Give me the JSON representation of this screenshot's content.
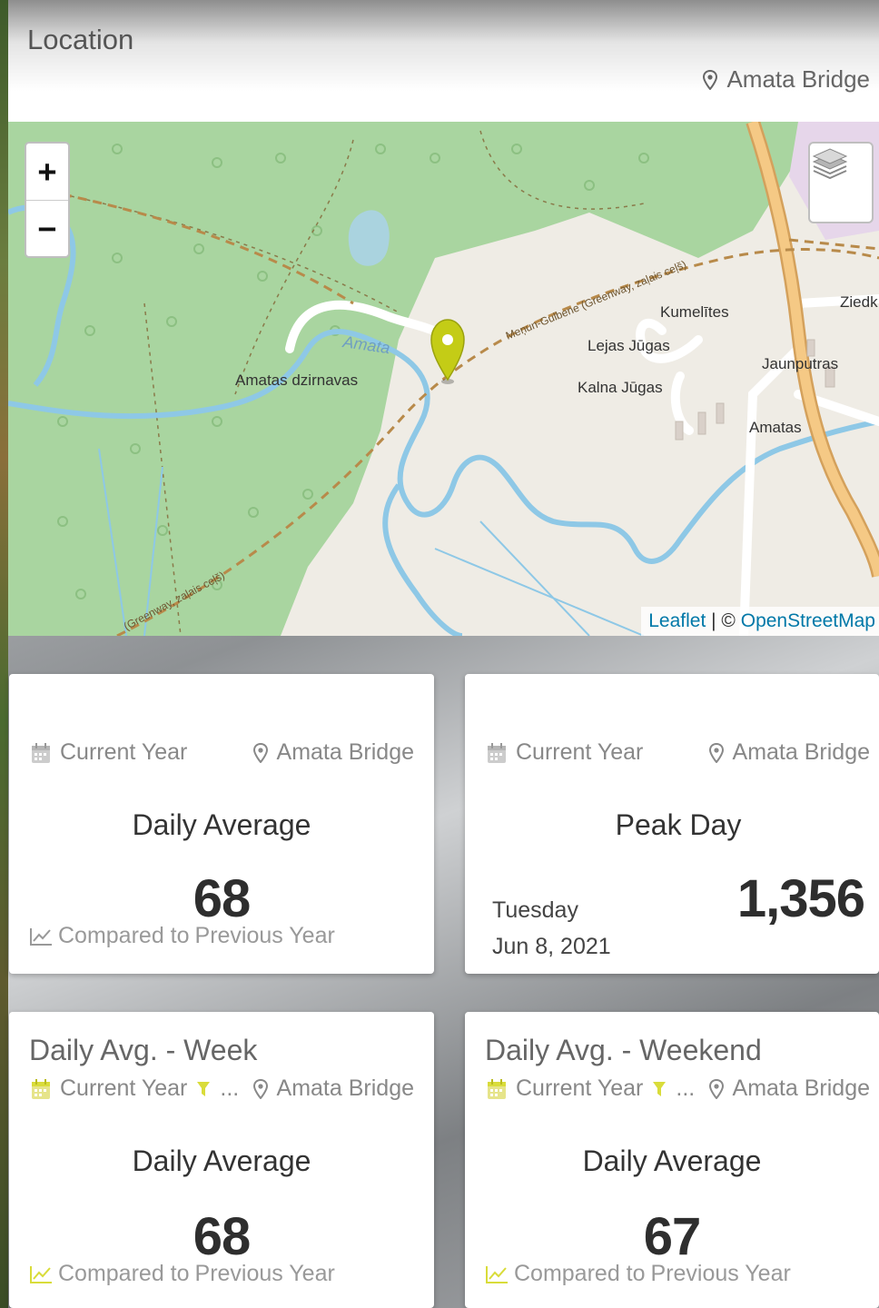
{
  "location": {
    "title": "Location",
    "place": "Amata Bridge"
  },
  "map": {
    "zoom_in": "+",
    "zoom_out": "−",
    "labels": {
      "river": "Amata",
      "mill": "Amatas dzirnavas",
      "kumelites": "Kumelītes",
      "lejas": "Lejas Jūgas",
      "kalna": "Kalna Jūgas",
      "jaunputras": "Jaunputras",
      "amatas": "Amatas",
      "ziedk": "Ziedk",
      "railway_top": "Meņun-Gulbene (Greenway, zaļais ceļš)",
      "railway_bottom": "(Greenway, zaļais ceļš)"
    },
    "attribution": {
      "leaflet": "Leaflet",
      "separator": " | © ",
      "osm": "OpenStreetMap"
    },
    "colors": {
      "forest": "#a9d5a0",
      "land": "#efece5",
      "river": "#8ec8e6",
      "road": "#f2c27a",
      "marker": "#c4cc16",
      "accent": "#d9dc3a"
    }
  },
  "cards": [
    {
      "period": "Current Year",
      "place": "Amata Bridge",
      "heading": "Daily Average",
      "value": "68",
      "compare_a": "Compared to",
      "compare_b": "Previous Year"
    },
    {
      "period": "Current Year",
      "place": "Amata Bridge",
      "heading": "Peak Day",
      "value": "1,356",
      "day": "Tuesday",
      "date": "Jun 8, 2021"
    },
    {
      "title": "Daily Avg. - Week",
      "period": "Current Year",
      "filter_more": "...",
      "place": "Amata Bridge",
      "heading": "Daily Average",
      "value": "68",
      "compare_a": "Compared to",
      "compare_b": "Previous Year"
    },
    {
      "title": "Daily Avg. - Weekend",
      "period": "Current Year",
      "filter_more": "...",
      "place": "Amata Bridge",
      "heading": "Daily Average",
      "value": "67",
      "compare_a": "Compared to",
      "compare_b": "Previous Year"
    }
  ]
}
